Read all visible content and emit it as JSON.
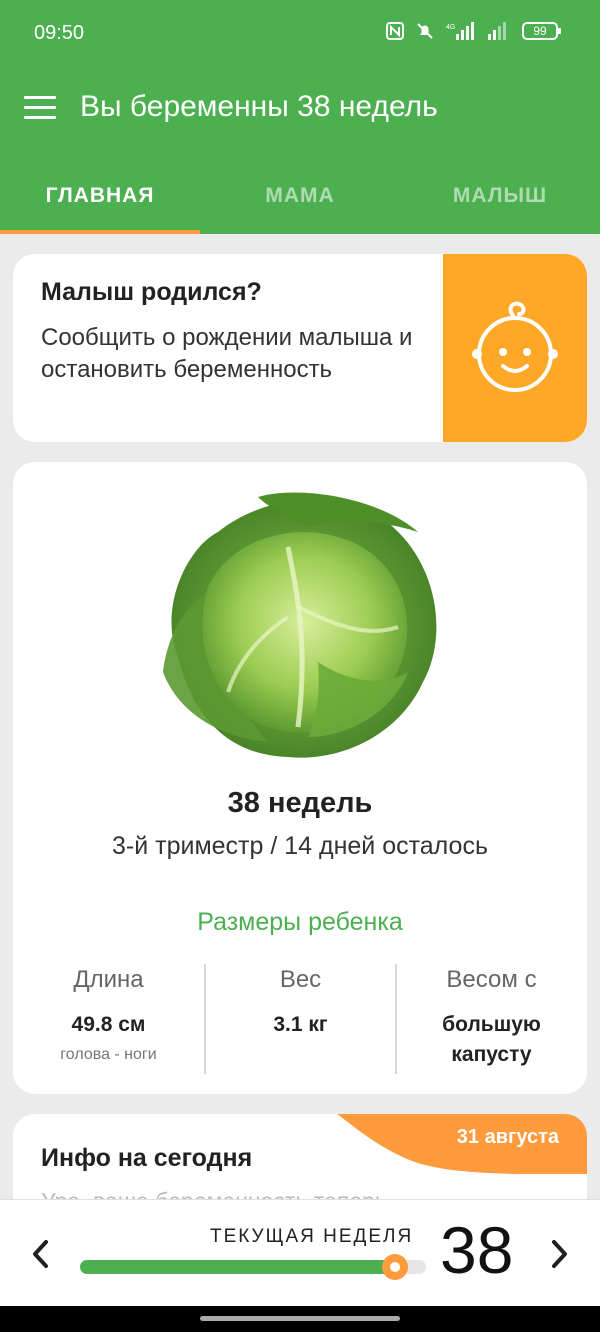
{
  "status_bar": {
    "time": "09:50",
    "battery": "99",
    "network": "4G"
  },
  "app_bar": {
    "title": "Вы беременны 38 недель",
    "menu_icon": "hamburger-menu-icon"
  },
  "tabs": [
    {
      "label": "ГЛАВНАЯ",
      "active": true
    },
    {
      "label": "МАМА",
      "active": false
    },
    {
      "label": "МАЛЫШ",
      "active": false
    }
  ],
  "born_card": {
    "title": "Малыш родился?",
    "description": "Сообщить о рождении малыша и остановить беременность",
    "icon": "baby-face-icon",
    "accent_color": "#ffa726"
  },
  "week_card": {
    "image": "cabbage-illustration",
    "weeks": "38 недель",
    "trimester": "3-й триместр / 14 дней осталось",
    "sizes_title": "Размеры ребенка",
    "metrics": [
      {
        "label": "Длина",
        "value": "49.8 см",
        "sub": "голова - ноги"
      },
      {
        "label": "Вес",
        "value": "3.1 кг",
        "sub": ""
      },
      {
        "label": "Весом с",
        "value": "большую капусту",
        "sub": ""
      }
    ]
  },
  "info_card": {
    "title": "Инфо на сегодня",
    "date": "31 августа",
    "preview": "Ура, ваша беременность теперь"
  },
  "bottom": {
    "current_label": "ТЕКУЩАЯ НЕДЕЛЯ",
    "week": "38",
    "progress_fraction": 0.91
  },
  "colors": {
    "primary": "#4caf50",
    "accent": "#ff9b3d",
    "background": "#ebebeb"
  }
}
